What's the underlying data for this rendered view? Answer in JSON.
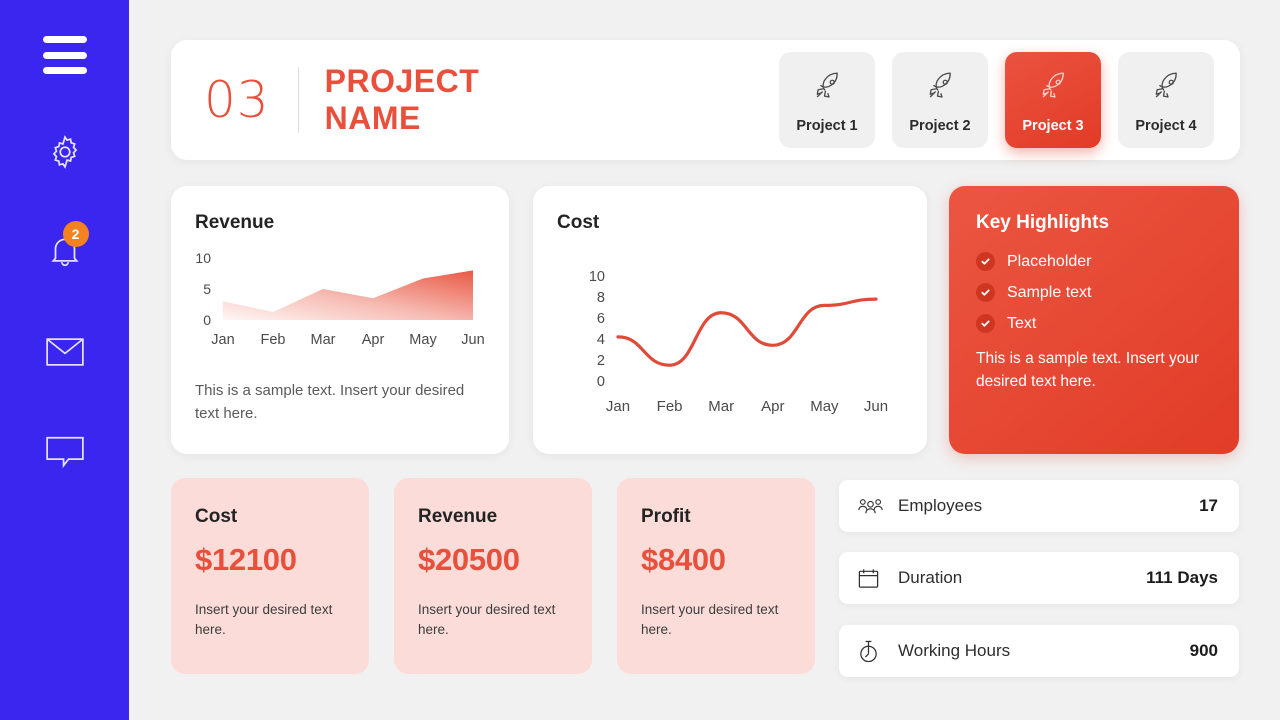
{
  "sidebar": {
    "menu_icon": "hamburger-menu-icon",
    "items": [
      {
        "icon": "gear-icon",
        "badge": null
      },
      {
        "icon": "bell-icon",
        "badge": "2"
      },
      {
        "icon": "envelope-icon",
        "badge": null
      },
      {
        "icon": "chat-bubble-icon",
        "badge": null
      }
    ],
    "background_color": "#3a26ee",
    "badge_color": "#f58220"
  },
  "header": {
    "number": "03",
    "title": "PROJECT NAME",
    "tabs": [
      {
        "label": "Project 1",
        "icon": "rocket-icon",
        "active": false
      },
      {
        "label": "Project 2",
        "icon": "rocket-icon",
        "active": false
      },
      {
        "label": "Project 3",
        "icon": "rocket-icon",
        "active": true
      },
      {
        "label": "Project 4",
        "icon": "rocket-icon",
        "active": false
      }
    ]
  },
  "revenue_card": {
    "title": "Revenue",
    "note": "This is a sample text. Insert your desired text here."
  },
  "cost_card": {
    "title": "Cost"
  },
  "highlights": {
    "title": "Key Highlights",
    "items": [
      {
        "label": "Placeholder",
        "icon": "check-circle-icon"
      },
      {
        "label": "Sample text",
        "icon": "check-circle-icon"
      },
      {
        "label": "Text",
        "icon": "check-circle-icon"
      }
    ],
    "note": "This is a sample text. Insert your desired text here.",
    "accent_color": "#e8452f"
  },
  "metrics": [
    {
      "title": "Cost",
      "value": "$12100",
      "note": "Insert your desired text here."
    },
    {
      "title": "Revenue",
      "value": "$20500",
      "note": "Insert your desired text here."
    },
    {
      "title": "Profit",
      "value": "$8400",
      "note": "Insert your desired text here."
    }
  ],
  "stats": [
    {
      "icon": "people-icon",
      "label": "Employees",
      "value": "17"
    },
    {
      "icon": "calendar-icon",
      "label": "Duration",
      "value": "111 Days"
    },
    {
      "icon": "stopwatch-icon",
      "label": "Working Hours",
      "value": "900"
    }
  ],
  "chart_data": [
    {
      "type": "area",
      "title": "Revenue",
      "categories": [
        "Jan",
        "Feb",
        "Mar",
        "Apr",
        "May",
        "Jun"
      ],
      "values": [
        3,
        1.3,
        5,
        3.5,
        6.7,
        8
      ],
      "yticks": [
        0,
        5,
        10
      ],
      "ylim": [
        0,
        10
      ],
      "xlabel": "",
      "ylabel": "",
      "grid": false,
      "legend": "none",
      "fill": "gradient light-pink to red (left-bottom to right-top)",
      "line_color": "#e8503c"
    },
    {
      "type": "line",
      "title": "Cost",
      "categories": [
        "Jan",
        "Feb",
        "Mar",
        "Apr",
        "May",
        "Jun"
      ],
      "values": [
        4.2,
        1.5,
        6.5,
        3.4,
        7.2,
        7.8
      ],
      "yticks": [
        0,
        2,
        4,
        6,
        8,
        10
      ],
      "ylim": [
        0,
        10
      ],
      "xlabel": "",
      "ylabel": "",
      "grid": false,
      "legend": "none",
      "line_color": "#e04a38",
      "smooth": true
    }
  ]
}
